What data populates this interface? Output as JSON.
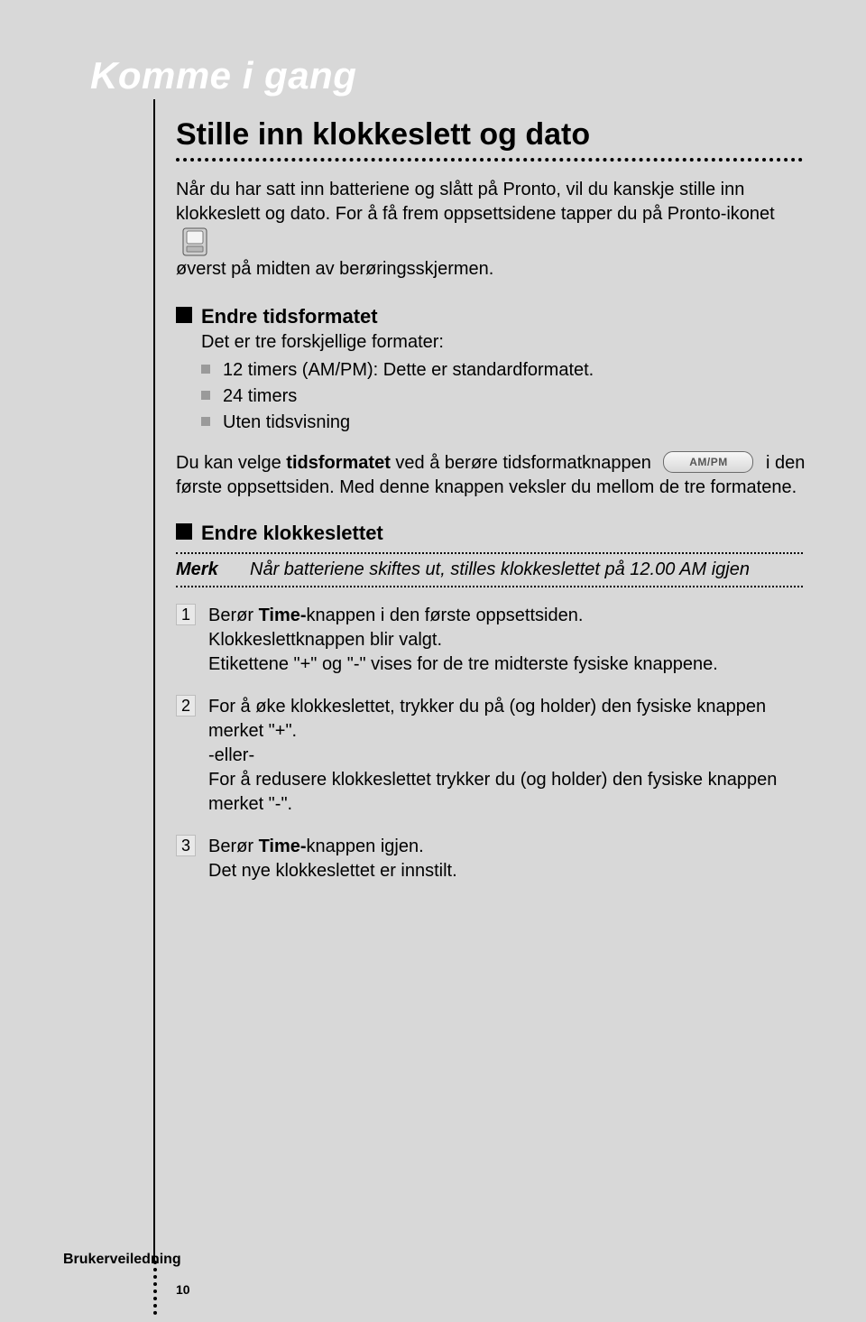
{
  "chapter_title": "Komme i gang",
  "section_title": "Stille inn klokkeslett og dato",
  "intro_line1": "Når du har satt inn batteriene og slått på Pronto, vil du kanskje stille inn",
  "intro_line2": "klokkeslett og dato. For å få frem oppsettsidene tapper du på Pronto-ikonet",
  "intro_line3": "øverst på midten av berøringsskjermen.",
  "sub1_title": "Endre tidsformatet",
  "sub1_text": "Det er tre forskjellige formater:",
  "bullets": [
    "12 timers (AM/PM): Dette er standardformatet.",
    "24 timers",
    "Uten tidsvisning"
  ],
  "para_a": "Du kan velge ",
  "para_b_bold": "tidsformatet",
  "para_c": " ved å berøre tidsformatknappen ",
  "ampm_label": "AM/PM",
  "para_d": " i den første oppsettsiden. Med denne knappen veksler du mellom de tre formatene.",
  "sub2_title": "Endre klokkeslettet",
  "note_label": "Merk",
  "note_text": "Når batteriene skiftes ut, stilles klokkeslettet på 12.00 AM  igjen",
  "steps": [
    {
      "num": "1",
      "l1a": "Berør ",
      "l1b": "Time-",
      "l1c": "knappen i den første oppsettsiden.",
      "l2": "Klokkeslettknappen blir valgt.",
      "l3": "Etikettene \"+\" og \"-\" vises for de tre midterste fysiske knappene."
    },
    {
      "num": "2",
      "l1": "For å øke klokkeslettet, trykker du på (og holder) den fysiske knappen merket \"+\".",
      "l2": "-eller-",
      "l3": "For å redusere klokkeslettet trykker du (og holder) den fysiske knappen merket \"-\"."
    },
    {
      "num": "3",
      "l1a": "Berør ",
      "l1b": "Time-",
      "l1c": "knappen igjen.",
      "l2": "Det nye klokkeslettet er innstilt."
    }
  ],
  "footer_label": "Brukerveiledning",
  "page_number": "10"
}
